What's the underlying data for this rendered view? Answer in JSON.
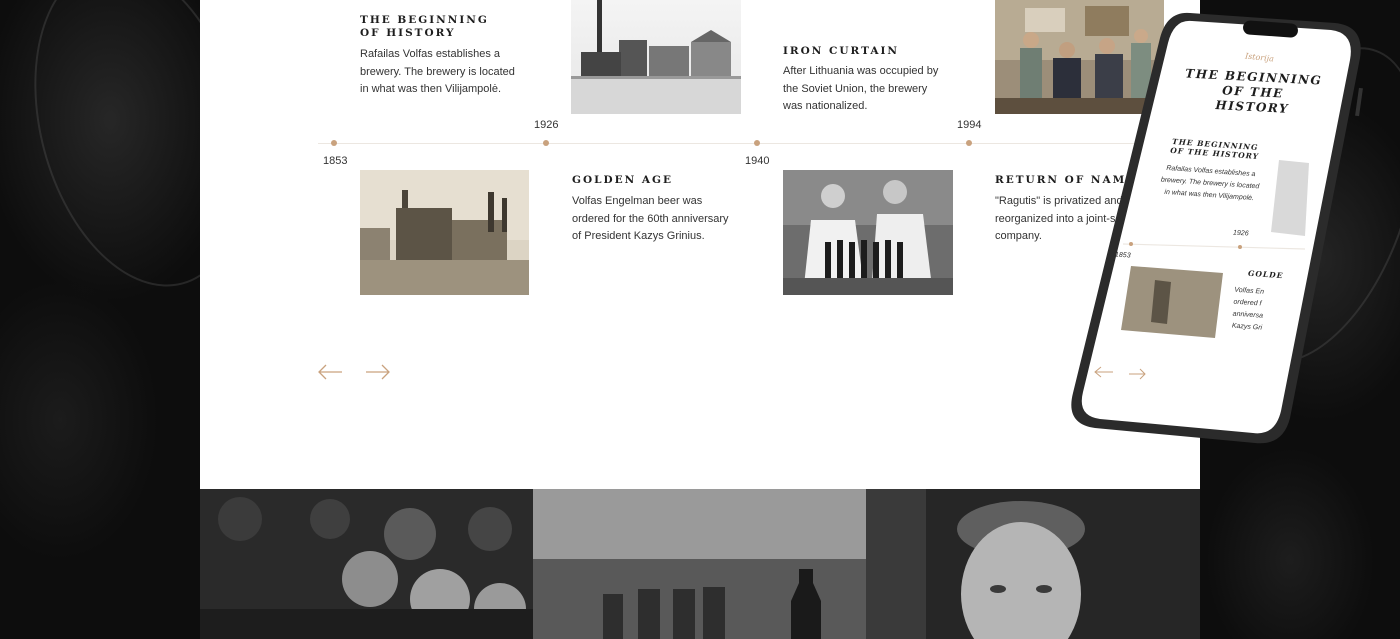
{
  "timeline": {
    "years": [
      "1853",
      "1926",
      "1940",
      "1994"
    ],
    "events": [
      {
        "title": "The beginning of history",
        "text": "Rafailas Volfas establishes a brewery. The brewery is located in what was then Vilijampolė."
      },
      {
        "title": "Golden age",
        "text": "Volfas Engelman beer was ordered for the 60th anniversary of President Kazys Grinius."
      },
      {
        "title": "Iron curtain",
        "text": "After Lithuania was occupied by the Soviet Union, the brewery was nationalized."
      },
      {
        "title": "Return of name",
        "text": "\"Ragutis\" is privatized and reorganized into a joint-s company."
      }
    ],
    "nav": {
      "prev_icon": "arrow-left-icon",
      "next_icon": "arrow-right-icon"
    }
  },
  "phone": {
    "kicker": "Istorija",
    "heading": "THE BEGINNING OF THE HISTORY",
    "event_title": "THE BEGINNING OF THE HISTORY",
    "event_text": "Rafailas Volfas establishes a brewery. The brewery is located in what was then Vilijampolė.",
    "year_1": "1853",
    "year_2": "1926",
    "event2_title": "GOLDE",
    "event2_text": "Volfas En ordered f anniversa Kazys Gri"
  },
  "colors": {
    "accent": "#c9a27e",
    "panel": "#ffffff",
    "background": "#0d0d0d",
    "text": "#333333"
  }
}
